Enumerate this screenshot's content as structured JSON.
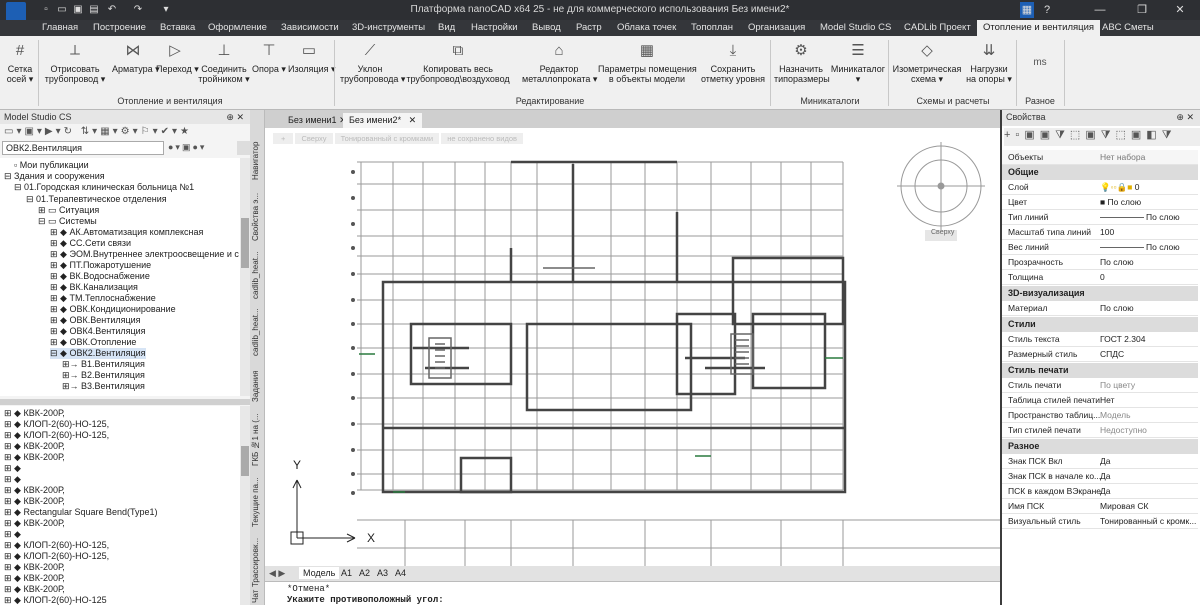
{
  "titlebar": {
    "title": "Платформа nanoCAD x64 25 - не для коммерческого использования Без имени2*"
  },
  "ribbon_tabs": [
    "Главная",
    "Построение",
    "Вставка",
    "Оформление",
    "Зависимости",
    "3D-инструменты",
    "Вид",
    "Настройки",
    "Вывод",
    "Растр",
    "Облака точек",
    "Топоплан",
    "Организация",
    "Model Studio CS",
    "CADLib Проект",
    "Отопление и вентиляция",
    "ABC Сметы"
  ],
  "ribbon": {
    "buttons": [
      {
        "l1": "Сетка",
        "l2": "осей ▾",
        "icon": "#"
      },
      {
        "l1": "Отрисовать",
        "l2": "трубопровод ▾",
        "icon": "⟂"
      },
      {
        "l1": "Арматура ▾",
        "l2": "",
        "icon": "⋈"
      },
      {
        "l1": "Переход ▾",
        "l2": "",
        "icon": "▷"
      },
      {
        "l1": "Соединить",
        "l2": "тройником ▾",
        "icon": "⊥"
      },
      {
        "l1": "Опора ▾",
        "l2": "",
        "icon": "⊤"
      },
      {
        "l1": "Изоляция ▾",
        "l2": "",
        "icon": "▭"
      },
      {
        "l1": "Уклон",
        "l2": "трубопровода ▾",
        "icon": "⟋"
      },
      {
        "l1": "Копировать весь",
        "l2": "трубопровод\\воздуховод",
        "icon": "⧉"
      },
      {
        "l1": "Редактор",
        "l2": "металлопроката ▾",
        "icon": "⌂"
      },
      {
        "l1": "Параметры помещения",
        "l2": "в объекты модели",
        "icon": "▦"
      },
      {
        "l1": "Сохранить",
        "l2": "отметку уровня",
        "icon": "⤓"
      },
      {
        "l1": "Назначить",
        "l2": "типоразмеры",
        "icon": "⚙"
      },
      {
        "l1": "Миникаталог",
        "l2": "▾",
        "icon": "☰"
      },
      {
        "l1": "Изометрическая",
        "l2": "схема ▾",
        "icon": "◇"
      },
      {
        "l1": "Нагрузки",
        "l2": "на опоры ▾",
        "icon": "⇊"
      },
      {
        "l1": "",
        "l2": "",
        "icon": "ms"
      }
    ],
    "groups": [
      "Отопление и вентиляция",
      "Редактирование",
      "Миникаталоги",
      "Схемы и расчеты",
      "Разное"
    ]
  },
  "left_panel": {
    "title": "Model Studio CS",
    "filter_value": "ОВК2.Вентиляция",
    "tree": [
      "Мои публикации",
      "Здания и сооружения",
      "01.Городская клиническая больница №1",
      "01.Терапевтическое отделения",
      "Ситуация",
      "Системы",
      "АК.Автоматизация комплексная",
      "СС.Сети связи",
      "ЭОМ.Внутреннее электроосвещение и с",
      "ПТ.Пожаротушение",
      "ВК.Водоснабжение",
      "ВК.Канализация",
      "ТМ.Теплоснабжение",
      "ОВК.Кондиционирование",
      "ОВК.Вентиляция",
      "ОВК4.Вентиляция",
      "ОВК.Отопление",
      "ОВК2.Вентиляция",
      "В1.Вентиляция",
      "В2.Вентиляция",
      "В3.Вентиляция"
    ],
    "objects": [
      "КВК-200Р,",
      "КЛОП-2(60)-НО-125,",
      "КЛОП-2(60)-НО-125,",
      "КВК-200Р,",
      "КВК-200Р,",
      "",
      "",
      "КВК-200Р,",
      "КВК-200Р,",
      "Rectangular Square Bend(Type1)",
      "КВК-200Р,",
      "",
      "КЛОП-2(60)-НО-125,",
      "КЛОП-2(60)-НО-125,",
      "КВК-200Р,",
      "КВК-200Р,",
      "КВК-200Р,",
      "КВК-200Р,",
      "КЛОП-2(60)-НО-125"
    ]
  },
  "side_tabs": [
    "Навигатор",
    "Свойства э...",
    "cadlib_heat...",
    "cadlib_heat...",
    "Задания",
    "ГКБ №1 на (...",
    "Текущие па...",
    "Трассировк...",
    "Чат"
  ],
  "doc_tabs": [
    "Без имени1",
    "Без имени2*"
  ],
  "viewport": {
    "crumbs": [
      "Сверху",
      "Тонированный с кромками",
      "не сохранено видов"
    ],
    "viewcube_label": "Сверху",
    "axis_y": "Y",
    "axis_x": "X"
  },
  "layout_tabs": [
    "Модель",
    "A1",
    "A2",
    "A3",
    "A4"
  ],
  "command": {
    "line1": "*Отмена*",
    "line2": "Укажите противоположный угол:"
  },
  "properties": {
    "title": "Свойства",
    "objects_label": "Объекты",
    "objects_value": "Нет набора",
    "sections": [
      {
        "cat": "Общие",
        "rows": [
          [
            "Слой",
            "0"
          ],
          [
            "Цвет",
            "По слою"
          ],
          [
            "Тип линий",
            "По слою"
          ],
          [
            "Масштаб типа линий",
            "100"
          ],
          [
            "Вес линий",
            "По слою"
          ],
          [
            "Прозрачность",
            "По слою"
          ],
          [
            "Толщина",
            "0"
          ]
        ]
      },
      {
        "cat": "3D-визуализация",
        "rows": [
          [
            "Материал",
            "По слою"
          ]
        ]
      },
      {
        "cat": "Стили",
        "rows": [
          [
            "Стиль текста",
            "ГОСТ 2.304"
          ],
          [
            "Размерный стиль",
            "СПДС"
          ]
        ]
      },
      {
        "cat": "Стиль печати",
        "rows": [
          [
            "Стиль печати",
            "По цвету"
          ],
          [
            "Таблица стилей печати",
            "Нет"
          ],
          [
            "Пространство таблиц...",
            "Модель"
          ],
          [
            "Тип стилей печати",
            "Недоступно"
          ]
        ]
      },
      {
        "cat": "Разное",
        "rows": [
          [
            "Знак ПСК Вкл",
            "Да"
          ],
          [
            "Знак ПСК в начале ко...",
            "Да"
          ],
          [
            "ПСК в каждом ВЭкране",
            "Да"
          ],
          [
            "Имя ПСК",
            "Мировая СК"
          ],
          [
            "Визуальный стиль",
            "Тонированный с кромк..."
          ]
        ]
      }
    ]
  }
}
